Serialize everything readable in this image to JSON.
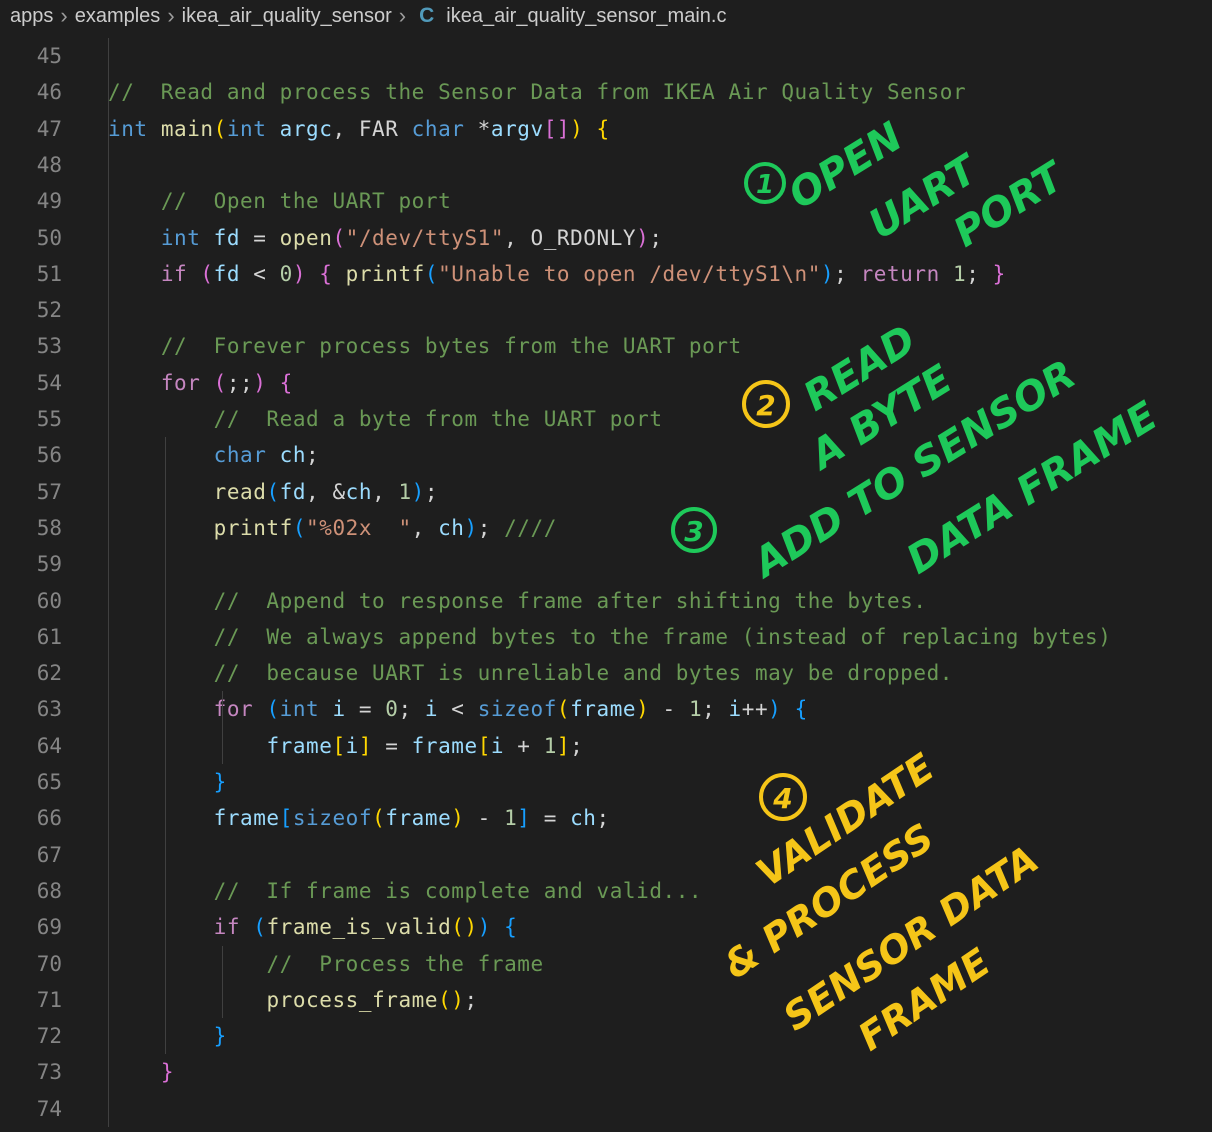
{
  "breadcrumb": {
    "items": [
      "apps",
      "examples",
      "ikea_air_quality_sensor"
    ],
    "file_icon": "C",
    "file": "ikea_air_quality_sensor_main.c"
  },
  "editor": {
    "lines": [
      {
        "n": "45",
        "t": []
      },
      {
        "n": "46",
        "t": [
          [
            "cm",
            "//  Read and process the Sensor Data from IKEA Air Quality Sensor"
          ]
        ]
      },
      {
        "n": "47",
        "t": [
          [
            "kw",
            "int"
          ],
          [
            "pn",
            " "
          ],
          [
            "fn",
            "main"
          ],
          [
            "br1",
            "("
          ],
          [
            "kw",
            "int"
          ],
          [
            "pn",
            " "
          ],
          [
            "var",
            "argc"
          ],
          [
            "pn",
            ", FAR "
          ],
          [
            "kw",
            "char"
          ],
          [
            "pn",
            " *"
          ],
          [
            "var",
            "argv"
          ],
          [
            "br2",
            "[]"
          ],
          [
            "br1",
            ")"
          ],
          [
            "pn",
            " "
          ],
          [
            "br1",
            "{"
          ]
        ]
      },
      {
        "n": "48",
        "t": []
      },
      {
        "n": "49",
        "t": [
          [
            "pn",
            "    "
          ],
          [
            "cm",
            "//  Open the UART port"
          ]
        ]
      },
      {
        "n": "50",
        "t": [
          [
            "pn",
            "    "
          ],
          [
            "kw",
            "int"
          ],
          [
            "pn",
            " "
          ],
          [
            "var",
            "fd"
          ],
          [
            "pn",
            " = "
          ],
          [
            "fn",
            "open"
          ],
          [
            "br2",
            "("
          ],
          [
            "str",
            "\"/dev/ttyS1\""
          ],
          [
            "pn",
            ", O_RDONLY"
          ],
          [
            "br2",
            ")"
          ],
          [
            "pn",
            ";"
          ]
        ]
      },
      {
        "n": "51",
        "t": [
          [
            "pn",
            "    "
          ],
          [
            "ctl",
            "if"
          ],
          [
            "pn",
            " "
          ],
          [
            "br2",
            "("
          ],
          [
            "var",
            "fd"
          ],
          [
            "pn",
            " < "
          ],
          [
            "num",
            "0"
          ],
          [
            "br2",
            ")"
          ],
          [
            "pn",
            " "
          ],
          [
            "br2",
            "{"
          ],
          [
            "pn",
            " "
          ],
          [
            "fn",
            "printf"
          ],
          [
            "br3",
            "("
          ],
          [
            "str",
            "\"Unable to open /dev/ttyS1\\n\""
          ],
          [
            "br3",
            ")"
          ],
          [
            "pn",
            "; "
          ],
          [
            "ctl",
            "return"
          ],
          [
            "pn",
            " "
          ],
          [
            "num",
            "1"
          ],
          [
            "pn",
            "; "
          ],
          [
            "br2",
            "}"
          ]
        ]
      },
      {
        "n": "52",
        "t": []
      },
      {
        "n": "53",
        "t": [
          [
            "pn",
            "    "
          ],
          [
            "cm",
            "//  Forever process bytes from the UART port"
          ]
        ]
      },
      {
        "n": "54",
        "t": [
          [
            "pn",
            "    "
          ],
          [
            "ctl",
            "for"
          ],
          [
            "pn",
            " "
          ],
          [
            "br2",
            "("
          ],
          [
            "pn",
            ";;"
          ],
          [
            "br2",
            ")"
          ],
          [
            "pn",
            " "
          ],
          [
            "br2",
            "{"
          ]
        ]
      },
      {
        "n": "55",
        "t": [
          [
            "pn",
            "        "
          ],
          [
            "cm",
            "//  Read a byte from the UART port"
          ]
        ]
      },
      {
        "n": "56",
        "t": [
          [
            "pn",
            "        "
          ],
          [
            "kw",
            "char"
          ],
          [
            "pn",
            " "
          ],
          [
            "var",
            "ch"
          ],
          [
            "pn",
            ";"
          ]
        ]
      },
      {
        "n": "57",
        "t": [
          [
            "pn",
            "        "
          ],
          [
            "fn",
            "read"
          ],
          [
            "br3",
            "("
          ],
          [
            "var",
            "fd"
          ],
          [
            "pn",
            ", &"
          ],
          [
            "var",
            "ch"
          ],
          [
            "pn",
            ", "
          ],
          [
            "num",
            "1"
          ],
          [
            "br3",
            ")"
          ],
          [
            "pn",
            ";"
          ]
        ]
      },
      {
        "n": "58",
        "t": [
          [
            "pn",
            "        "
          ],
          [
            "fn",
            "printf"
          ],
          [
            "br3",
            "("
          ],
          [
            "str",
            "\"%02x  \""
          ],
          [
            "pn",
            ", "
          ],
          [
            "var",
            "ch"
          ],
          [
            "br3",
            ")"
          ],
          [
            "pn",
            "; "
          ],
          [
            "cm",
            "////"
          ]
        ]
      },
      {
        "n": "59",
        "t": []
      },
      {
        "n": "60",
        "t": [
          [
            "pn",
            "        "
          ],
          [
            "cm",
            "//  Append to response frame after shifting the bytes."
          ]
        ]
      },
      {
        "n": "61",
        "t": [
          [
            "pn",
            "        "
          ],
          [
            "cm",
            "//  We always append bytes to the frame (instead of replacing bytes)"
          ]
        ]
      },
      {
        "n": "62",
        "t": [
          [
            "pn",
            "        "
          ],
          [
            "cm",
            "//  because UART is unreliable and bytes may be dropped."
          ]
        ]
      },
      {
        "n": "63",
        "t": [
          [
            "pn",
            "        "
          ],
          [
            "ctl",
            "for"
          ],
          [
            "pn",
            " "
          ],
          [
            "br3",
            "("
          ],
          [
            "kw",
            "int"
          ],
          [
            "pn",
            " "
          ],
          [
            "var",
            "i"
          ],
          [
            "pn",
            " = "
          ],
          [
            "num",
            "0"
          ],
          [
            "pn",
            "; "
          ],
          [
            "var",
            "i"
          ],
          [
            "pn",
            " < "
          ],
          [
            "kw",
            "sizeof"
          ],
          [
            "br1",
            "("
          ],
          [
            "var",
            "frame"
          ],
          [
            "br1",
            ")"
          ],
          [
            "pn",
            " - "
          ],
          [
            "num",
            "1"
          ],
          [
            "pn",
            "; "
          ],
          [
            "var",
            "i"
          ],
          [
            "pn",
            "++"
          ],
          [
            "br3",
            ")"
          ],
          [
            "pn",
            " "
          ],
          [
            "br3",
            "{"
          ]
        ]
      },
      {
        "n": "64",
        "t": [
          [
            "pn",
            "            "
          ],
          [
            "var",
            "frame"
          ],
          [
            "br1",
            "["
          ],
          [
            "var",
            "i"
          ],
          [
            "br1",
            "]"
          ],
          [
            "pn",
            " = "
          ],
          [
            "var",
            "frame"
          ],
          [
            "br1",
            "["
          ],
          [
            "var",
            "i"
          ],
          [
            "pn",
            " + "
          ],
          [
            "num",
            "1"
          ],
          [
            "br1",
            "]"
          ],
          [
            "pn",
            ";"
          ]
        ]
      },
      {
        "n": "65",
        "t": [
          [
            "pn",
            "        "
          ],
          [
            "br3",
            "}"
          ]
        ]
      },
      {
        "n": "66",
        "t": [
          [
            "pn",
            "        "
          ],
          [
            "var",
            "frame"
          ],
          [
            "br3",
            "["
          ],
          [
            "kw",
            "sizeof"
          ],
          [
            "br1",
            "("
          ],
          [
            "var",
            "frame"
          ],
          [
            "br1",
            ")"
          ],
          [
            "pn",
            " - "
          ],
          [
            "num",
            "1"
          ],
          [
            "br3",
            "]"
          ],
          [
            "pn",
            " = "
          ],
          [
            "var",
            "ch"
          ],
          [
            "pn",
            ";"
          ]
        ]
      },
      {
        "n": "67",
        "t": []
      },
      {
        "n": "68",
        "t": [
          [
            "pn",
            "        "
          ],
          [
            "cm",
            "//  If frame is complete and valid..."
          ]
        ]
      },
      {
        "n": "69",
        "t": [
          [
            "pn",
            "        "
          ],
          [
            "ctl",
            "if"
          ],
          [
            "pn",
            " "
          ],
          [
            "br3",
            "("
          ],
          [
            "fn",
            "frame_is_valid"
          ],
          [
            "br1",
            "()"
          ],
          [
            "br3",
            ")"
          ],
          [
            "pn",
            " "
          ],
          [
            "br3",
            "{"
          ]
        ]
      },
      {
        "n": "70",
        "t": [
          [
            "pn",
            "            "
          ],
          [
            "cm",
            "//  Process the frame"
          ]
        ]
      },
      {
        "n": "71",
        "t": [
          [
            "pn",
            "            "
          ],
          [
            "fn",
            "process_frame"
          ],
          [
            "br1",
            "()"
          ],
          [
            "pn",
            ";"
          ]
        ]
      },
      {
        "n": "72",
        "t": [
          [
            "pn",
            "        "
          ],
          [
            "br3",
            "}"
          ]
        ]
      },
      {
        "n": "73",
        "t": [
          [
            "pn",
            "    "
          ],
          [
            "br2",
            "}"
          ]
        ]
      },
      {
        "n": "74",
        "t": []
      }
    ]
  },
  "annotations": {
    "step1": {
      "num": "1",
      "lines": [
        "OPEN",
        "UART",
        "PORT"
      ],
      "color": "#1ec95a"
    },
    "step2": {
      "num": "2",
      "lines": [
        "READ",
        "A BYTE"
      ],
      "color": "#f5c518"
    },
    "step2_text_color": "#1ec95a",
    "step3": {
      "num": "3",
      "lines": [
        "ADD TO SENSOR",
        "DATA FRAME"
      ],
      "color": "#1ec95a"
    },
    "step4": {
      "num": "4",
      "lines": [
        "VALIDATE",
        "& PROCESS",
        "SENSOR DATA",
        "FRAME"
      ],
      "color": "#f5c518"
    }
  }
}
